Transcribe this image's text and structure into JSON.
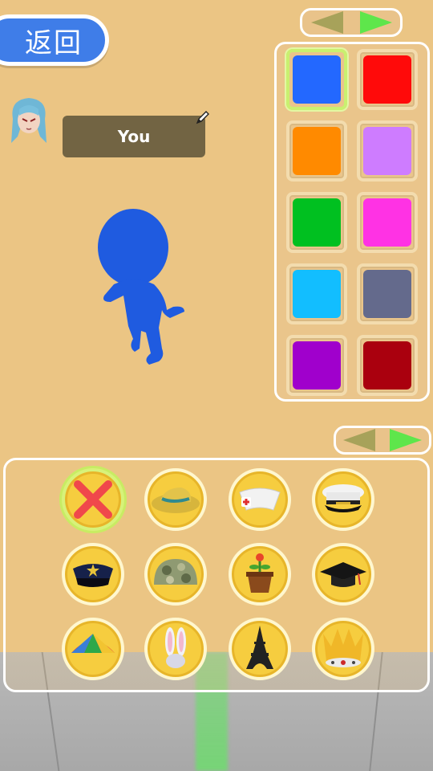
{
  "back_button": {
    "label": "返回"
  },
  "player": {
    "name": "You"
  },
  "color_pager": {
    "prev": "prev-arrow",
    "next": "next-arrow"
  },
  "hat_pager": {
    "prev": "prev-arrow",
    "next": "next-arrow"
  },
  "colors": {
    "selected_index": 0,
    "swatches": [
      "#2368ff",
      "#ff0a0a",
      "#ff8a00",
      "#ce7cff",
      "#00c020",
      "#ff32e4",
      "#12beff",
      "#646a8c",
      "#a000cc",
      "#aa000e"
    ]
  },
  "character_color": "#1f5be0",
  "hats": {
    "selected_index": 0,
    "items": [
      "none-x-icon",
      "straw-hat-icon",
      "nurse-cap-icon",
      "captain-hat-icon",
      "police-cap-icon",
      "camo-helmet-icon",
      "flower-pot-hat-icon",
      "graduation-cap-icon",
      "umbrella-hat-icon",
      "bunny-ears-icon",
      "eiffel-tower-hat-icon",
      "crown-icon"
    ]
  }
}
